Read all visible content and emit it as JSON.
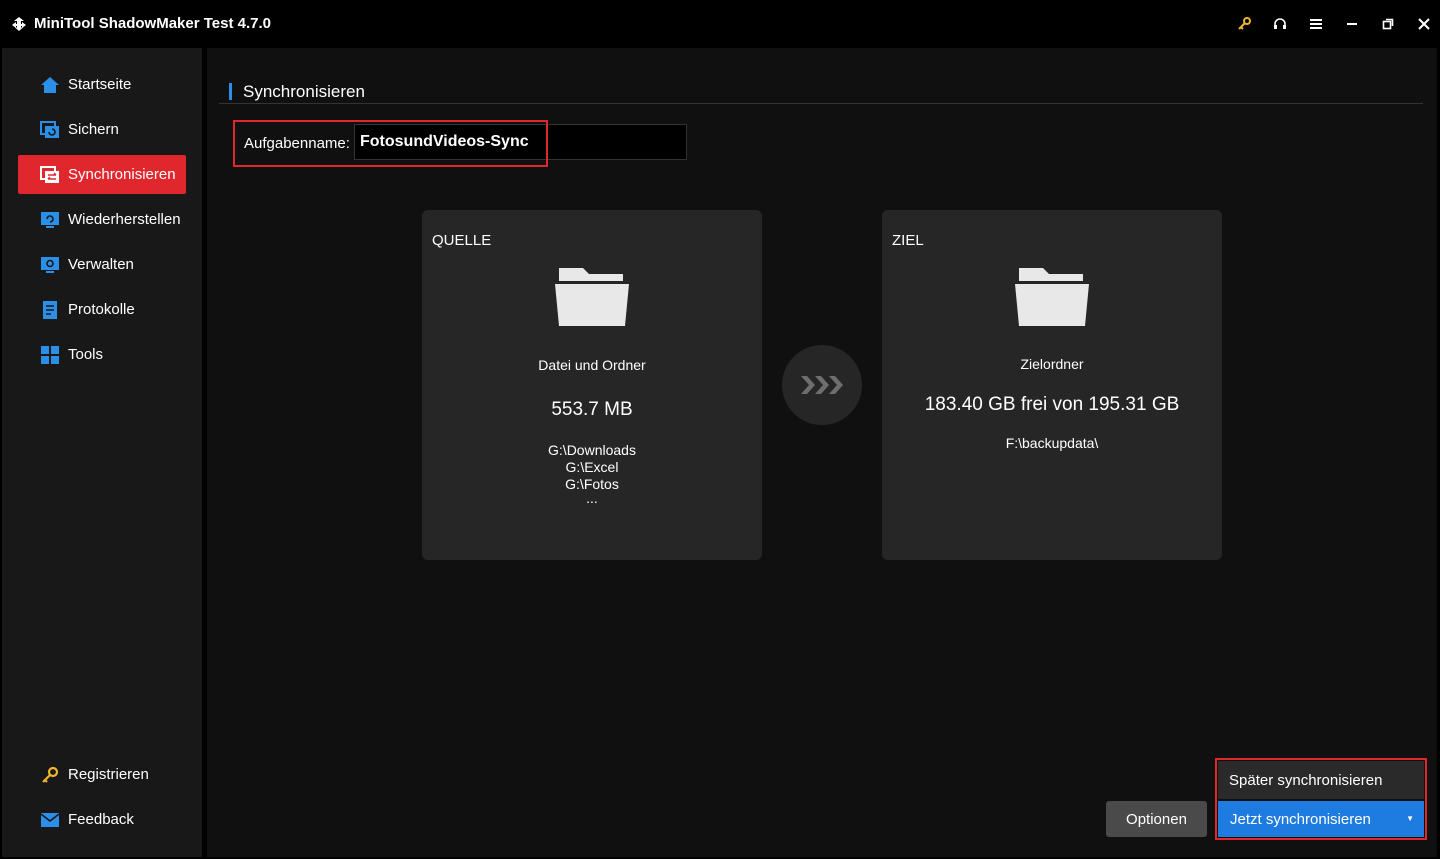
{
  "app": {
    "title": "MiniTool ShadowMaker Test 4.7.0"
  },
  "titlebar": {
    "icons": [
      "key-icon",
      "headset-icon",
      "menu-icon",
      "minimize-icon",
      "restore-icon",
      "close-icon"
    ],
    "key_color": "#f0b62b"
  },
  "sidebar": {
    "items": [
      {
        "label": "Startseite",
        "icon": "home-icon"
      },
      {
        "label": "Sichern",
        "icon": "backup-icon"
      },
      {
        "label": "Synchronisieren",
        "icon": "sync-icon",
        "active": true
      },
      {
        "label": "Wiederherstellen",
        "icon": "restore-icon"
      },
      {
        "label": "Verwalten",
        "icon": "manage-icon"
      },
      {
        "label": "Protokolle",
        "icon": "logs-icon"
      },
      {
        "label": "Tools",
        "icon": "tools-icon"
      }
    ],
    "bottom": [
      {
        "label": "Registrieren",
        "icon": "key-icon"
      },
      {
        "label": "Feedback",
        "icon": "mail-icon"
      }
    ],
    "active_color": "#e0272d",
    "icon_color": "#2b8fe8"
  },
  "main": {
    "section_title": "Synchronisieren",
    "task_label": "Aufgabenname:",
    "task_value": "FotosundVideos-Sync",
    "source": {
      "heading": "QUELLE",
      "type": "Datei und Ordner",
      "size": "553.7 MB",
      "paths": [
        "G:\\Downloads",
        "G:\\Excel",
        "G:\\Fotos",
        "..."
      ]
    },
    "target": {
      "heading": "ZIEL",
      "type": "Zielordner",
      "space": "183.40 GB frei von 195.31 GB",
      "path": "F:\\backupdata\\"
    },
    "buttons": {
      "options": "Optionen",
      "sync_later": "Später synchronisieren",
      "sync_now": "Jetzt synchronisieren"
    },
    "accent_color": "#1e7be0"
  }
}
